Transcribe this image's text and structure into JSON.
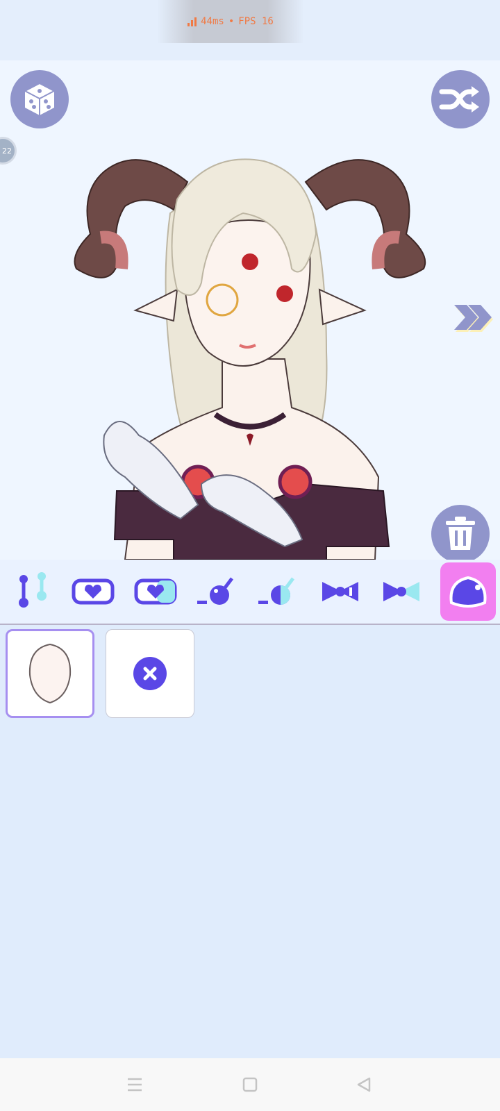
{
  "status": {
    "ping": "44ms",
    "separator": "•",
    "fps": "FPS 16"
  },
  "canvas": {
    "level_badge": "22"
  },
  "toolbar": {
    "random_icon": "dice-icon",
    "shuffle_icon": "shuffle-icon",
    "next_icon": "double-chevron-right-icon",
    "delete_icon": "trash-icon"
  },
  "categories": [
    {
      "icon": "accessory-pin-icon",
      "active": false
    },
    {
      "icon": "heart-badge-icon",
      "active": false
    },
    {
      "icon": "heart-badge-alt-icon",
      "active": false
    },
    {
      "icon": "ball-stick-icon",
      "active": false
    },
    {
      "icon": "ball-stick-alt-icon",
      "active": false
    },
    {
      "icon": "bow-icon",
      "active": false
    },
    {
      "icon": "bow-alt-icon",
      "active": false
    },
    {
      "icon": "blob-icon",
      "active": true
    }
  ],
  "items": [
    {
      "icon": "face-shape-icon",
      "selected": true
    },
    {
      "icon": "remove-icon",
      "selected": false
    }
  ],
  "colors": {
    "accent": "#5a47e6",
    "active_tab": "#f27ff0",
    "button": "#9095cb",
    "selected_border": "#a68ff0"
  }
}
